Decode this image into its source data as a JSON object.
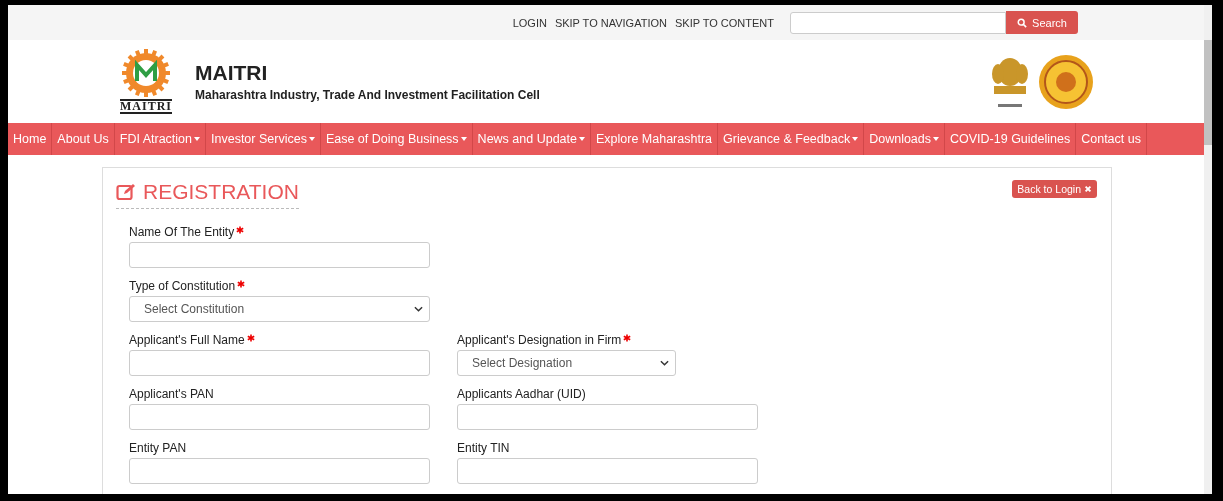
{
  "top_bar": {
    "links": [
      "LOGIN",
      "SKIP TO NAVIGATION",
      "SKIP TO CONTENT"
    ],
    "search_button": "Search"
  },
  "header": {
    "title": "MAITRI",
    "subtitle": "Maharashtra Industry, Trade And Investment Facilitation Cell",
    "logo_caption": "MAITRI"
  },
  "nav": [
    {
      "label": "Home",
      "has_dropdown": false
    },
    {
      "label": "About Us",
      "has_dropdown": false
    },
    {
      "label": "FDI Atraction",
      "has_dropdown": true
    },
    {
      "label": "Investor Services",
      "has_dropdown": true
    },
    {
      "label": "Ease of Doing Business",
      "has_dropdown": true
    },
    {
      "label": "News and Update",
      "has_dropdown": true
    },
    {
      "label": "Explore Maharashtra",
      "has_dropdown": false
    },
    {
      "label": "Grievance & Feedback",
      "has_dropdown": true
    },
    {
      "label": "Downloads",
      "has_dropdown": true
    },
    {
      "label": "COVID-19 Guidelines",
      "has_dropdown": false
    },
    {
      "label": "Contact us",
      "has_dropdown": false
    }
  ],
  "form": {
    "title": "REGISTRATION",
    "back_button": "Back to Login",
    "rows": [
      [
        {
          "label": "Name Of The Entity",
          "required": true,
          "kind": "text"
        }
      ],
      [
        {
          "label": "Type of Constitution",
          "required": true,
          "kind": "select",
          "placeholder": "Select Constitution"
        }
      ],
      [
        {
          "label": "Applicant's Full Name",
          "required": true,
          "kind": "text"
        },
        {
          "label": "Applicant's Designation in Firm",
          "required": true,
          "kind": "shortselect",
          "placeholder": "Select Designation"
        }
      ],
      [
        {
          "label": "Applicant's PAN",
          "required": false,
          "kind": "text"
        },
        {
          "label": "Applicants Aadhar (UID)",
          "required": false,
          "kind": "text"
        }
      ],
      [
        {
          "label": "Entity PAN",
          "required": false,
          "kind": "text"
        },
        {
          "label": "Entity TIN",
          "required": false,
          "kind": "text"
        }
      ]
    ]
  }
}
